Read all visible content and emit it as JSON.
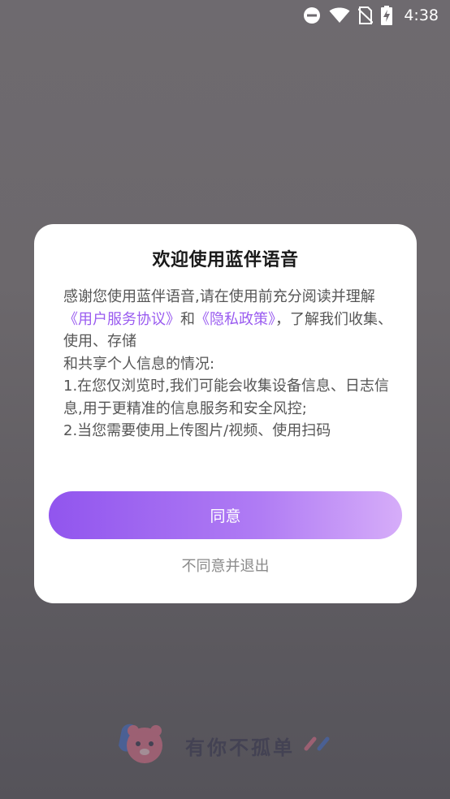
{
  "status_bar": {
    "time": "4:38",
    "icons": [
      "do-not-disturb-icon",
      "wifi-icon",
      "no-sim-icon",
      "battery-charging-icon"
    ]
  },
  "dialog": {
    "title": "欢迎使用蓝伴语音",
    "body": {
      "intro_before": "感谢您使用蓝伴语音,请在使用前充分阅读并理解",
      "user_agreement_link": "《用户服务协议》",
      "and_text": "和",
      "privacy_policy_link": "《隐私政策》",
      "intro_after": "，了解我们收集、使用、存储",
      "line2": "和共享个人信息的情况:",
      "item1": "1.在您仅浏览时,我们可能会收集设备信息、日志信息,用于更精准的信息服务和安全风控;",
      "item2": "2.当您需要使用上传图片/视频、使用扫码"
    },
    "agree_label": "同意",
    "reject_label": "不同意并退出"
  },
  "brand": {
    "slogan": "有你不孤单"
  },
  "colors": {
    "accent": "#9a5cf0",
    "button_gradient_start": "#9155ee",
    "button_gradient_end": "#d6adf9",
    "overlay": "#6c686c"
  }
}
